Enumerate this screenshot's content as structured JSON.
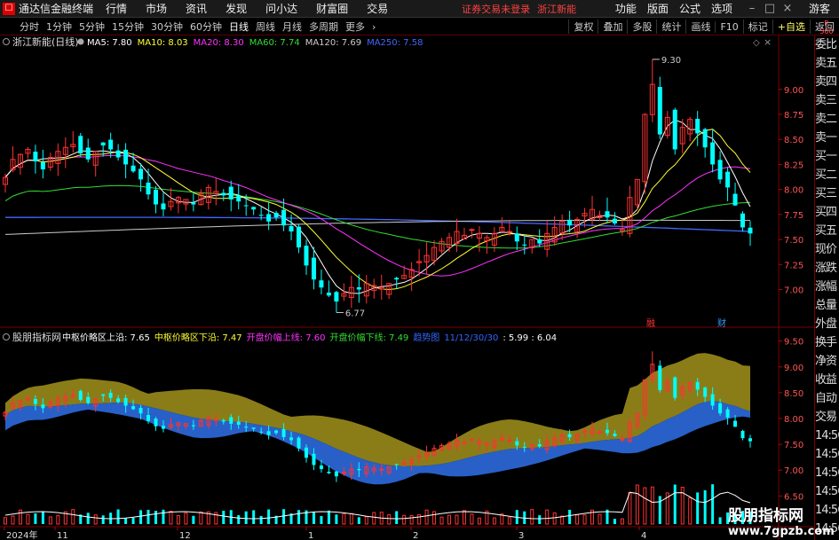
{
  "app": {
    "title": "通达信金融终端",
    "menu": [
      "行情",
      "市场",
      "资讯",
      "发现",
      "问小达",
      "财富圈",
      "交易"
    ],
    "alert": "证券交易未登录",
    "stock_label": "浙江新能",
    "right_menu": [
      "功能",
      "版面",
      "公式",
      "选项"
    ],
    "guest": "游客"
  },
  "tabs": {
    "left": [
      "分时",
      "1分钟",
      "5分钟",
      "15分钟",
      "30分钟",
      "60分钟",
      "日线",
      "周线",
      "月线",
      "多周期",
      "更多"
    ],
    "active": "日线",
    "right": [
      "复权",
      "叠加",
      "多股",
      "统计",
      "画线",
      "F10",
      "标记",
      "+自选",
      "返回"
    ]
  },
  "right_tag": [
    "R",
    "500"
  ],
  "right_panel": [
    "委比",
    "卖五",
    "卖四",
    "卖三",
    "卖二",
    "卖一",
    "买一",
    "买二",
    "买三",
    "买四",
    "买五",
    "现价",
    "涨跌",
    "涨幅",
    "总量",
    "外盘",
    "换手",
    "净资",
    "收益",
    "自动",
    "交易",
    "14:56",
    "14:56",
    "14:56",
    "14:56",
    "14:56",
    "14:56",
    "14:56"
  ],
  "main_panel": {
    "title": "浙江新能(日线)",
    "ma_labels": [
      {
        "text": "MA5: 7.80",
        "color": "#ffffff"
      },
      {
        "text": "MA10: 8.03",
        "color": "#ffff33"
      },
      {
        "text": "MA20: 8.30",
        "color": "#ff33ff"
      },
      {
        "text": "MA60: 7.74",
        "color": "#33dd33"
      },
      {
        "text": "MA120: 7.69",
        "color": "#cccccc"
      },
      {
        "text": "MA250: 7.58",
        "color": "#4466ff"
      }
    ],
    "high_label": "9.30",
    "low_label": "6.77",
    "y_ticks": [
      "9.00",
      "8.75",
      "8.50",
      "8.25",
      "8.00",
      "7.75",
      "7.50",
      "7.25",
      "7.00"
    ],
    "event_labels": [
      "融",
      "财"
    ]
  },
  "sub_panel": {
    "title": "股朋指标网",
    "labels": [
      {
        "text": "中枢价略区上沿: 7.65",
        "color": "#ffffff"
      },
      {
        "text": "中枢价略区下沿: 7.47",
        "color": "#ffff33"
      },
      {
        "text": "开盘价幅上线: 7.60",
        "color": "#ff33ff"
      },
      {
        "text": "开盘价幅下线: 7.49",
        "color": "#33dd33"
      },
      {
        "text": "趋势图",
        "color": "#3366ff"
      },
      {
        "text": "11/12/30/30",
        "color": "#3366ff"
      },
      {
        "text": ": 5.99 : 6.04",
        "color": "#ffffff"
      }
    ],
    "y_ticks": [
      "9.50",
      "9.00",
      "8.50",
      "8.00",
      "7.50",
      "7.00",
      "6.50"
    ]
  },
  "x_axis": [
    "2024年",
    "11",
    "12",
    "1",
    "2",
    "3",
    "4"
  ],
  "watermark": {
    "line1": "股朋指标网",
    "line2": "www.7gpzb.com"
  },
  "colors": {
    "up": "#ff3232",
    "down": "#00ffff",
    "ma5": "#ffffff",
    "ma10": "#ffff33",
    "ma20": "#ff33ff",
    "ma60": "#33dd33",
    "ma120": "#cccccc",
    "ma250": "#4466ff",
    "band_olive": "#8a7d18",
    "band_blue": "#2860c8"
  },
  "chart_data": {
    "type": "candlestick",
    "series_close": [
      8.12,
      8.3,
      8.35,
      8.4,
      8.28,
      8.2,
      8.32,
      8.38,
      8.42,
      8.45,
      8.36,
      8.3,
      8.38,
      8.44,
      8.4,
      8.32,
      8.25,
      8.18,
      8.1,
      7.95,
      7.85,
      7.8,
      7.88,
      7.92,
      7.9,
      7.85,
      7.96,
      8.02,
      7.98,
      7.94,
      7.9,
      7.88,
      7.84,
      7.8,
      7.74,
      7.68,
      7.72,
      7.64,
      7.58,
      7.42,
      7.24,
      7.1,
      7.02,
      6.94,
      6.88,
      6.96,
      7.02,
      7.0,
      7.06,
      7.04,
      7.02,
      7.06,
      7.1,
      7.14,
      7.2,
      7.28,
      7.34,
      7.42,
      7.48,
      7.52,
      7.58,
      7.54,
      7.6,
      7.56,
      7.52,
      7.56,
      7.62,
      7.58,
      7.48,
      7.44,
      7.5,
      7.46,
      7.56,
      7.62,
      7.68,
      7.64,
      7.7,
      7.76,
      7.8,
      7.74,
      7.72,
      7.66,
      7.6,
      7.92,
      8.1,
      8.75,
      9.05,
      8.55,
      8.72,
      8.4,
      8.62,
      8.7,
      8.56,
      8.42,
      8.25,
      8.1,
      8.02,
      7.84,
      7.62,
      7.56
    ],
    "ma5_last": 7.8,
    "ma10_last": 8.03,
    "ma20_last": 8.3,
    "ma60_last": 7.74,
    "ma120_last": 7.69,
    "ma250_last": 7.58,
    "price_high": 9.3,
    "price_low": 6.77
  }
}
